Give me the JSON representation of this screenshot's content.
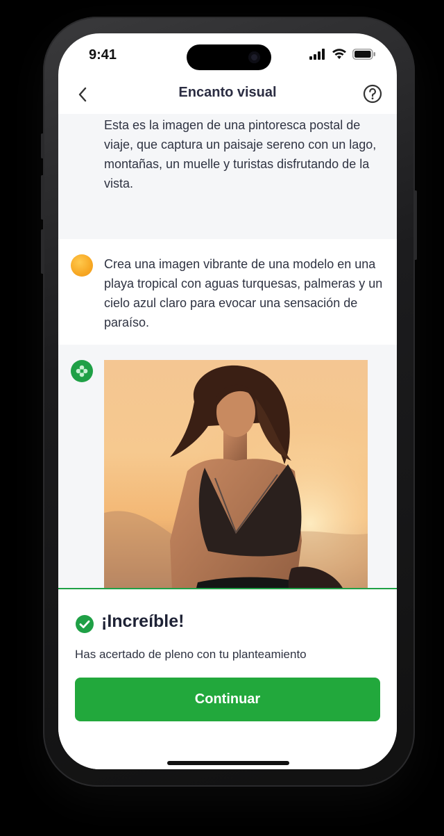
{
  "status_bar": {
    "time": "9:41"
  },
  "nav": {
    "title": "Encanto visual",
    "back_icon": "chevron-left-icon",
    "help_icon": "question-circle-icon"
  },
  "messages": [
    {
      "role": "assistant",
      "text": "Esta es la imagen de una pintoresca postal de viaje, que captura un paisaje sereno con un lago, montañas, un muelle y turistas disfrutando de la vista."
    },
    {
      "role": "user",
      "text": "Crea una imagen vibrante de una modelo en una playa tropical con aguas turquesas, palmeras y un cielo azul claro para evocar una sensación de paraíso."
    },
    {
      "role": "assistant",
      "content": "generated-image"
    }
  ],
  "result": {
    "title": "¡Increíble!",
    "text": "Has acertado de pleno con tu planteamiento",
    "button_label": "Continuar",
    "icon": "check-circle-icon"
  },
  "colors": {
    "accent_green": "#22a83c",
    "user_avatar": "#f7a824",
    "text_dark": "#2b2d42"
  }
}
